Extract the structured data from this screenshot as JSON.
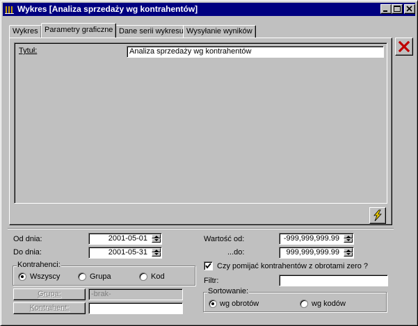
{
  "window": {
    "title": "Wykres [Analiza sprzedaży wg kontrahentów]"
  },
  "tabs": [
    {
      "label": "Wykres"
    },
    {
      "label": "Parametry graficzne"
    },
    {
      "label": "Dane serii wykresu"
    },
    {
      "label": "Wysyłanie wyników"
    }
  ],
  "active_tab": "Parametry graficzne",
  "graphics": {
    "title_label": "Tytuł:",
    "title_value": "Analiza sprzedaży wg kontrahentów"
  },
  "filters": {
    "date_from_label": "Od dnia:",
    "date_from": "2001-05-01",
    "date_to_label": "Do dnia:",
    "date_to": "2001-05-31",
    "value_from_label": "Wartość od:",
    "value_from": "-999,999,999.99",
    "value_to_label": "...do:",
    "value_to": "999,999,999.99",
    "contractors_group": "Kontrahenci:",
    "contractors_options": [
      "Wszyscy",
      "Grupa",
      "Kod"
    ],
    "contractors_selected": "Wszyscy",
    "group_button": "Grupa:",
    "group_value": "-brak-",
    "contractor_button": "Kontrahent:",
    "contractor_value": "",
    "skip_zero_label": "Czy pomijać kontrahentów z obrotami zero ?",
    "skip_zero_checked": true,
    "filter_label": "Filtr:",
    "filter_value": "",
    "sort_group": "Sortowanie:",
    "sort_options": [
      "wg obrotów",
      "wg kodów"
    ],
    "sort_selected": "wg obrotów"
  },
  "colors": {
    "title_bar": "#000080",
    "close_x": "#c00000",
    "lightning": "#e8c800"
  }
}
